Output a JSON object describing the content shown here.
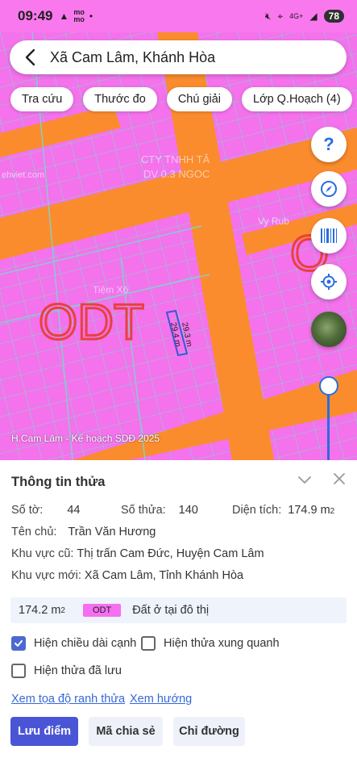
{
  "status_bar": {
    "time": "09:49",
    "battery": "78",
    "network": "4G+"
  },
  "search": {
    "location": "Xã Cam Lâm, Khánh Hòa"
  },
  "chips": [
    {
      "label": "Tra cứu"
    },
    {
      "label": "Thước đo"
    },
    {
      "label": "Chú giải"
    },
    {
      "label": "Lớp Q.Hoạch (4)"
    }
  ],
  "map": {
    "zone_label": "ODT",
    "zone_label_right": "O",
    "parcel_dim_1": "29.3 m",
    "parcel_dim_2": "29.4 m",
    "caption": "H.Cam Lâm - Kế hoạch SDĐ 2025",
    "watermark_1": "CTY TNHH TÂ",
    "watermark_2": "DV 0.3 NGOC",
    "watermark_3": "ehviet.com",
    "watermark_4": "Vy Rub",
    "watermark_5": "Tiệm Xô",
    "colors": {
      "zone_fill": "#f472ec",
      "road": "#fa8c2e",
      "parcel_line": "#7fd3cf",
      "zone_text": "#e8413e",
      "accent": "#2a6de0"
    }
  },
  "fabs": [
    {
      "name": "help-button",
      "icon": "question-icon"
    },
    {
      "name": "compass-button",
      "icon": "compass-icon"
    },
    {
      "name": "barcode-button",
      "icon": "barcode-icon"
    },
    {
      "name": "locate-button",
      "icon": "crosshair-icon"
    }
  ],
  "panel": {
    "title": "Thông tin thửa",
    "so_to_label": "Số tờ:",
    "so_to_value": "44",
    "so_thua_label": "Số thửa:",
    "so_thua_value": "140",
    "dien_tich_label": "Diện tích:",
    "dien_tich_value": "174.9 m",
    "dien_tich_sup": "2",
    "ten_chu_label": "Tên chủ:",
    "ten_chu_value": "Trần Văn Hương",
    "khu_vuc_cu_label": "Khu vực cũ:",
    "khu_vuc_cu_value": "Thị trấn Cam Đức, Huyện Cam Lâm",
    "khu_vuc_moi_label": "Khu vực mới:",
    "khu_vuc_moi_value": "Xã Cam Lâm, Tỉnh Khánh Hòa",
    "area_value": "174.2 m",
    "area_sup": "2",
    "area_tag": "ODT",
    "area_desc": "Đất ở tại đô thị",
    "check_1": "Hiện chiều dài cạnh",
    "check_1_checked": true,
    "check_2": "Hiện thửa xung quanh",
    "check_2_checked": false,
    "check_3": "Hiện thửa đã lưu",
    "check_3_checked": false,
    "link_1": "Xem tọa độ ranh thửa",
    "link_2": "Xem hướng",
    "btn_save": "Lưu điểm",
    "btn_share": "Mã chia sẻ",
    "btn_directions": "Chỉ đường"
  }
}
